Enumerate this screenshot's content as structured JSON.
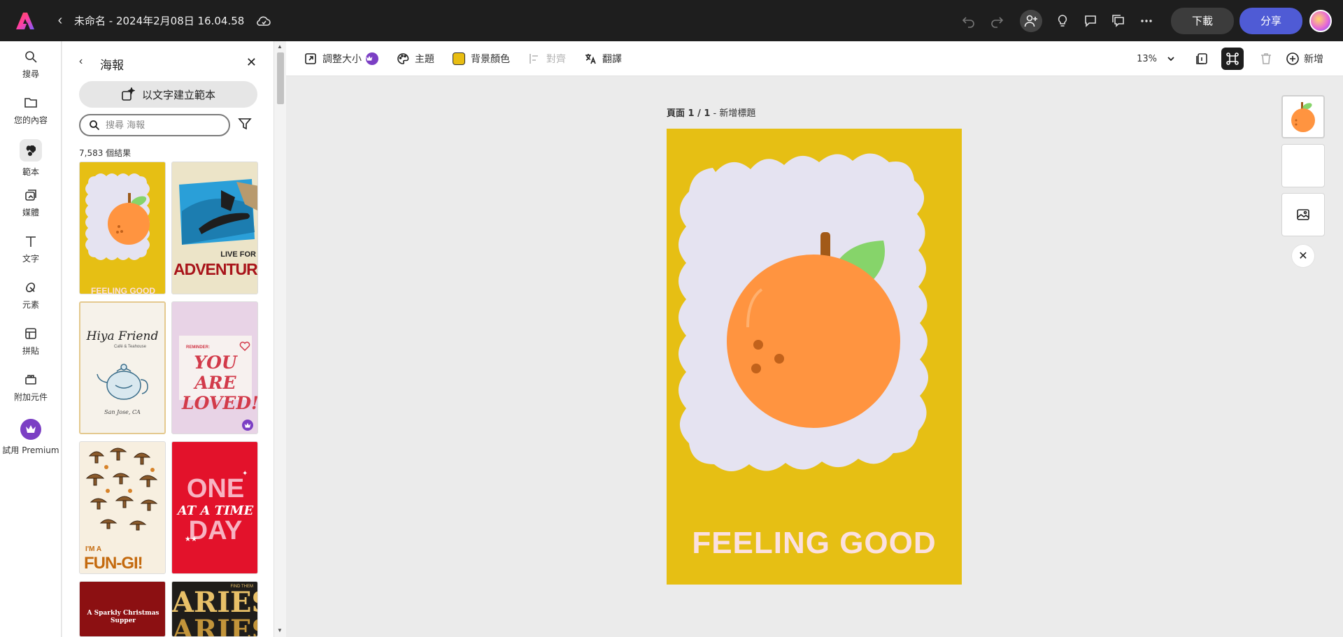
{
  "topbar": {
    "doc_title": "未命名 - 2024年2月08日 16.04.58",
    "download_label": "下載",
    "share_label": "分享",
    "icons": [
      "undo-icon",
      "redo-icon",
      "invite-icon",
      "lightbulb-icon",
      "comment-icon",
      "review-icon",
      "more-icon"
    ]
  },
  "rail": {
    "items": [
      {
        "label": "搜尋",
        "icon": "search-icon"
      },
      {
        "label": "您的內容",
        "icon": "folder-icon"
      },
      {
        "label": "範本",
        "icon": "templates-icon"
      },
      {
        "label": "媒體",
        "icon": "media-icon"
      },
      {
        "label": "文字",
        "icon": "text-icon"
      },
      {
        "label": "元素",
        "icon": "elements-icon"
      },
      {
        "label": "拼貼",
        "icon": "grid-icon"
      },
      {
        "label": "附加元件",
        "icon": "addons-icon"
      },
      {
        "label": "試用 Premium",
        "icon": "crown-icon"
      }
    ]
  },
  "panel": {
    "title": "海報",
    "create_from_text": "以文字建立範本",
    "search_placeholder": "搜尋 海報",
    "result_count": "7,583 個結果",
    "thumbs": [
      {
        "name": "feeling-good-template",
        "text": "FEELING GOOD"
      },
      {
        "name": "adventure-template",
        "text_top": "LIVE FOR",
        "text_main": "ADVENTURE"
      },
      {
        "name": "hiya-friend-template",
        "text": "Hiya Friend",
        "subtext": "Café & Teahouse",
        "footer": "San Jose, CA"
      },
      {
        "name": "you-are-loved-template",
        "text_small": "REMINDER:",
        "text_main": "YOU ARE LOVED!"
      },
      {
        "name": "fungi-template",
        "text_small": "I'M A",
        "text_main": "FUN-GI!"
      },
      {
        "name": "one-day-template",
        "line1": "ONE",
        "line2": "AT A TIME",
        "line3": "DAY"
      },
      {
        "name": "christmas-supper-template",
        "text": "A Sparkly Christmas Supper"
      },
      {
        "name": "aries-template",
        "text": "ARIES",
        "text_small": "FIND THEM"
      }
    ]
  },
  "toolbar": {
    "resize": "調整大小",
    "theme": "主題",
    "bg_color": "背景顏色",
    "align": "對齊",
    "translate": "翻譯",
    "zoom": "13%",
    "add": "新增",
    "bg_swatch": "#e8bd12"
  },
  "canvas": {
    "page_label_bold": "頁面 1 / 1",
    "page_label_rest": " - 新增標題",
    "poster_text": "FEELING GOOD",
    "poster_bg": "#e6bf14"
  }
}
